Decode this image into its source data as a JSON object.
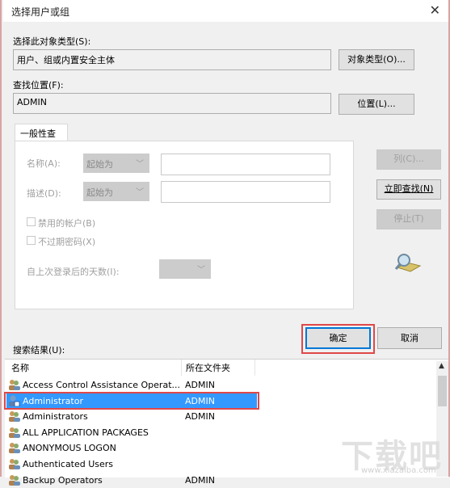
{
  "window": {
    "title": "选择用户或组",
    "close_icon": "close-icon"
  },
  "object_type": {
    "label": "选择此对象类型(S):",
    "value": "用户、组或内置安全主体",
    "button": "对象类型(O)..."
  },
  "location": {
    "label": "查找位置(F):",
    "value": "ADMIN",
    "button": "位置(L)..."
  },
  "query": {
    "tab": "一般性查询",
    "name_label": "名称(A):",
    "name_mode": "起始为",
    "desc_label": "描述(D):",
    "desc_mode": "起始为",
    "name_value": "",
    "desc_value": "",
    "disabled_accounts": {
      "label": "禁用的帐户(B)",
      "checked": false
    },
    "non_expiring_pw": {
      "label": "不过期密码(X)",
      "checked": false
    },
    "days_label": "自上次登录后的天数(I):",
    "days_value": ""
  },
  "side_buttons": {
    "columns": "列(C)...",
    "find_now": "立即查找(N)",
    "stop": "停止(T)"
  },
  "actions": {
    "ok": "确定",
    "cancel": "取消"
  },
  "results": {
    "label": "搜索结果(U):",
    "columns": [
      "名称",
      "所在文件夹"
    ],
    "rows": [
      {
        "name": "Access Control Assistance Operat...",
        "folder": "ADMIN",
        "icon": "group-icon",
        "selected": false
      },
      {
        "name": "Administrator",
        "folder": "ADMIN",
        "icon": "user-icon",
        "selected": true
      },
      {
        "name": "Administrators",
        "folder": "ADMIN",
        "icon": "group-icon",
        "selected": false
      },
      {
        "name": "ALL APPLICATION PACKAGES",
        "folder": "",
        "icon": "group-icon",
        "selected": false
      },
      {
        "name": "ANONYMOUS LOGON",
        "folder": "",
        "icon": "group-icon",
        "selected": false
      },
      {
        "name": "Authenticated Users",
        "folder": "",
        "icon": "group-icon",
        "selected": false
      },
      {
        "name": "Backup Operators",
        "folder": "ADMIN",
        "icon": "group-icon",
        "selected": false
      }
    ]
  },
  "watermark": {
    "text": "下载吧",
    "url": "www.xiazaiba.com"
  },
  "colors": {
    "selection": "#3399ff",
    "highlight": "#e04848",
    "focus": "#0078d7"
  }
}
